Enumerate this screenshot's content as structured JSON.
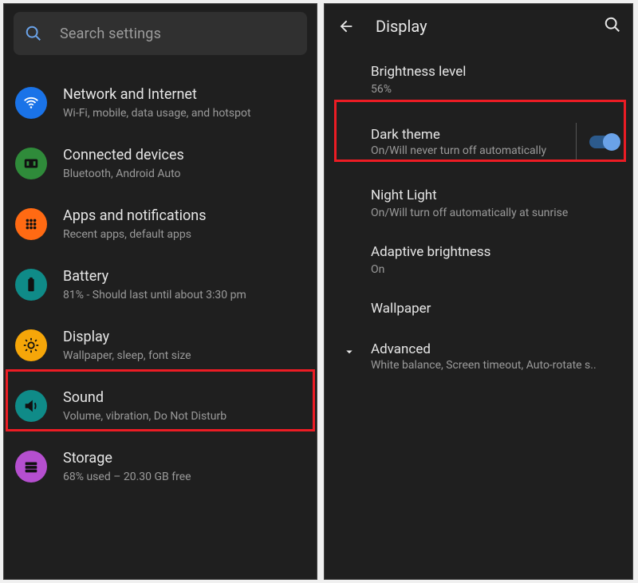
{
  "left": {
    "search_placeholder": "Search settings",
    "items": [
      {
        "title": "Network and Internet",
        "subtitle": "Wi-Fi, mobile, data usage, and hotspot"
      },
      {
        "title": "Connected devices",
        "subtitle": "Bluetooth, Android Auto"
      },
      {
        "title": "Apps and notifications",
        "subtitle": "Recent apps, default apps"
      },
      {
        "title": "Battery",
        "subtitle": "81% - Should last until about 3:30 pm"
      },
      {
        "title": "Display",
        "subtitle": "Wallpaper, sleep, font size"
      },
      {
        "title": "Sound",
        "subtitle": "Volume, vibration, Do Not Disturb"
      },
      {
        "title": "Storage",
        "subtitle": "68% used – 20.30 GB free"
      }
    ]
  },
  "right": {
    "header_title": "Display",
    "brightness": {
      "title": "Brightness level",
      "subtitle": "56%"
    },
    "dark_theme": {
      "title": "Dark theme",
      "subtitle": "On/Will never turn off automatically"
    },
    "night_light": {
      "title": "Night Light",
      "subtitle": "On/Will turn off automatically at sunrise"
    },
    "adaptive": {
      "title": "Adaptive brightness",
      "subtitle": "On"
    },
    "wallpaper": {
      "title": "Wallpaper"
    },
    "advanced": {
      "title": "Advanced",
      "subtitle": "White balance, Screen timeout, Auto-rotate s.."
    }
  }
}
